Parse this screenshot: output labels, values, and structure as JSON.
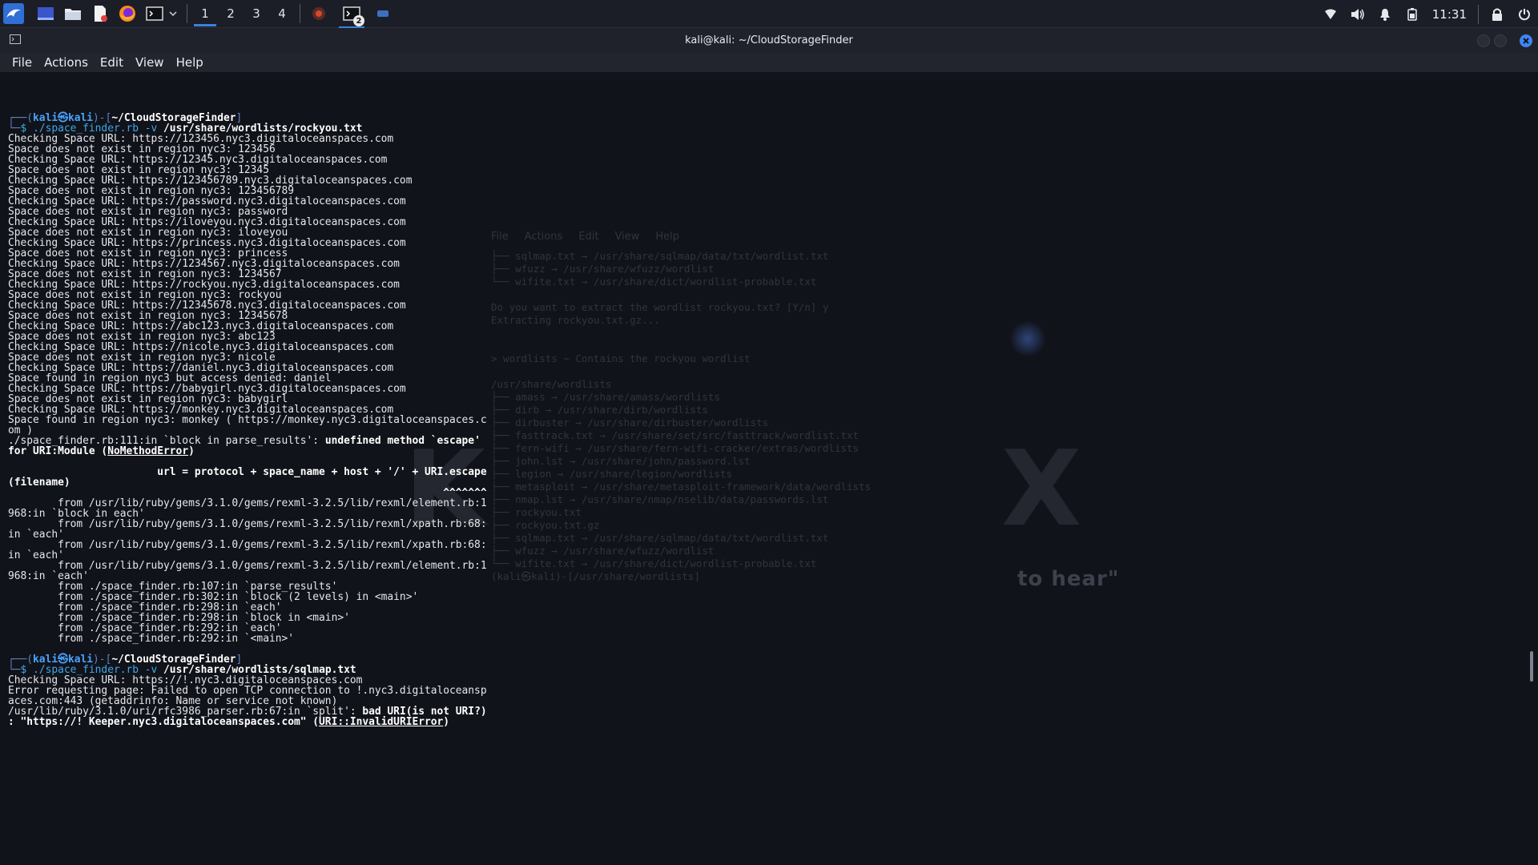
{
  "taskbar": {
    "workspaces": [
      "1",
      "2",
      "3",
      "4"
    ],
    "active_workspace": 0,
    "terminal_badge": "2",
    "clock": "11:31"
  },
  "window": {
    "title": "kali@kali: ~/CloudStorageFinder"
  },
  "menubar": {
    "items": [
      "File",
      "Actions",
      "Edit",
      "View",
      "Help"
    ]
  },
  "terminal": {
    "prompt1": {
      "user": "kali㉿kali",
      "dir": "~/CloudStorageFinder",
      "cmd": "./space_finder.rb -v",
      "arg": "/usr/share/wordlists/rockyou.txt"
    },
    "output1": [
      "Checking Space URL: https://123456.nyc3.digitaloceanspaces.com",
      "Space does not exist in region nyc3: 123456",
      "Checking Space URL: https://12345.nyc3.digitaloceanspaces.com",
      "Space does not exist in region nyc3: 12345",
      "Checking Space URL: https://123456789.nyc3.digitaloceanspaces.com",
      "Space does not exist in region nyc3: 123456789",
      "Checking Space URL: https://password.nyc3.digitaloceanspaces.com",
      "Space does not exist in region nyc3: password",
      "Checking Space URL: https://iloveyou.nyc3.digitaloceanspaces.com",
      "Space does not exist in region nyc3: iloveyou",
      "Checking Space URL: https://princess.nyc3.digitaloceanspaces.com",
      "Space does not exist in region nyc3: princess",
      "Checking Space URL: https://1234567.nyc3.digitaloceanspaces.com",
      "Space does not exist in region nyc3: 1234567",
      "Checking Space URL: https://rockyou.nyc3.digitaloceanspaces.com",
      "Space does not exist in region nyc3: rockyou",
      "Checking Space URL: https://12345678.nyc3.digitaloceanspaces.com",
      "Space does not exist in region nyc3: 12345678",
      "Checking Space URL: https://abc123.nyc3.digitaloceanspaces.com",
      "Space does not exist in region nyc3: abc123",
      "Checking Space URL: https://nicole.nyc3.digitaloceanspaces.com",
      "Space does not exist in region nyc3: nicole",
      "Checking Space URL: https://daniel.nyc3.digitaloceanspaces.com",
      "Space found in region nyc3 but access denied: daniel",
      "Checking Space URL: https://babygirl.nyc3.digitaloceanspaces.com",
      "Space does not exist in region nyc3: babygirl",
      "Checking Space URL: https://monkey.nyc3.digitaloceanspaces.com",
      "Space found in region nyc3: monkey ( https://monkey.nyc3.digitaloceanspaces.c",
      "om )"
    ],
    "error1": {
      "line1_pre": "./space_finder.rb:111:in `block in parse_results': ",
      "line1_bold": "undefined method `escape'",
      "line2_pre": "for URI:Module (",
      "line2_ul": "NoMethodError",
      "line2_post": ")",
      "code_line": "                        url = protocol + space_name + host + '/' + URI.escape",
      "code_line2": "(filename)",
      "caret": "                                                                      ^^^^^^^"
    },
    "trace1": [
      "        from /usr/lib/ruby/gems/3.1.0/gems/rexml-3.2.5/lib/rexml/element.rb:1",
      "968:in `block in each'",
      "        from /usr/lib/ruby/gems/3.1.0/gems/rexml-3.2.5/lib/rexml/xpath.rb:68:",
      "in `each'",
      "        from /usr/lib/ruby/gems/3.1.0/gems/rexml-3.2.5/lib/rexml/xpath.rb:68:",
      "in `each'",
      "        from /usr/lib/ruby/gems/3.1.0/gems/rexml-3.2.5/lib/rexml/element.rb:1",
      "968:in `each'",
      "        from ./space_finder.rb:107:in `parse_results'",
      "        from ./space_finder.rb:302:in `block (2 levels) in <main>'",
      "        from ./space_finder.rb:298:in `each'",
      "        from ./space_finder.rb:298:in `block in <main>'",
      "        from ./space_finder.rb:292:in `each'",
      "        from ./space_finder.rb:292:in `<main>'"
    ],
    "prompt2": {
      "user": "kali㉿kali",
      "dir": "~/CloudStorageFinder",
      "cmd": "./space_finder.rb -v",
      "arg": "/usr/share/wordlists/sqlmap.txt"
    },
    "output2": [
      "Checking Space URL: https://!.nyc3.digitaloceanspaces.com",
      "Error requesting page: Failed to open TCP connection to !.nyc3.digitaloceansp",
      "aces.com:443 (getaddrinfo: Name or service not known)"
    ],
    "error2": {
      "line1_pre": "/usr/lib/ruby/3.1.0/uri/rfc3986_parser.rb:67:in `split': ",
      "line1_bold": "bad URI(is not URI?)",
      "line2_bold": ": \"https://! Keeper.nyc3.digitaloceanspaces.com\" (",
      "line2_ul": "URI::InvalidURIError",
      "line2_post": ")"
    }
  },
  "background": {
    "ghost_menu": [
      "File",
      "Actions",
      "Edit",
      "View",
      "Help"
    ],
    "ghost_tagline": "to hear\""
  },
  "colors": {
    "accent": "#3c7fe0",
    "prompt_user": "#4aa3ff",
    "prompt_frame": "#5b82c6",
    "terminal_bg": "#11131a"
  }
}
